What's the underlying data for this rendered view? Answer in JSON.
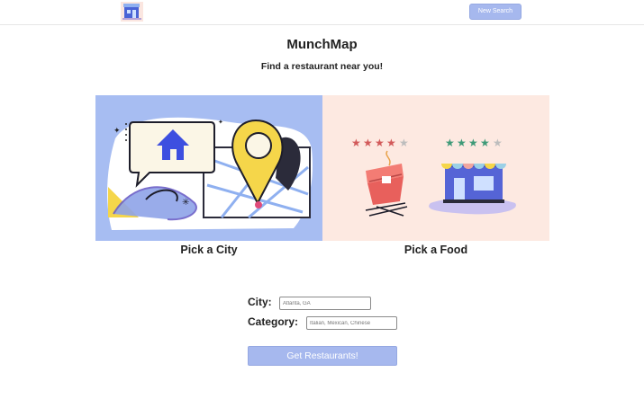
{
  "header": {
    "logo_icon": "restaurant-building-icon",
    "new_search_label": "New Search"
  },
  "main": {
    "title": "MunchMap",
    "subtitle": "Find a restaurant near you!"
  },
  "options": [
    {
      "label": "Pick a City",
      "illustration": "map-location-pin-icon"
    },
    {
      "label": "Pick a Food",
      "illustration": "food-ratings-icon"
    }
  ],
  "form": {
    "city_label": "City:",
    "city_placeholder": "Atlanta, GA",
    "category_label": "Category:",
    "category_placeholder": "Italian, Mexican, Chinese",
    "submit_label": "Get Restaurants!"
  },
  "colors": {
    "accent": "#a6b8ee",
    "city_panel": "#a7bdf2",
    "food_panel": "#fde9e1",
    "pin_yellow": "#f5d64a",
    "house_blue": "#3d4fe0"
  }
}
